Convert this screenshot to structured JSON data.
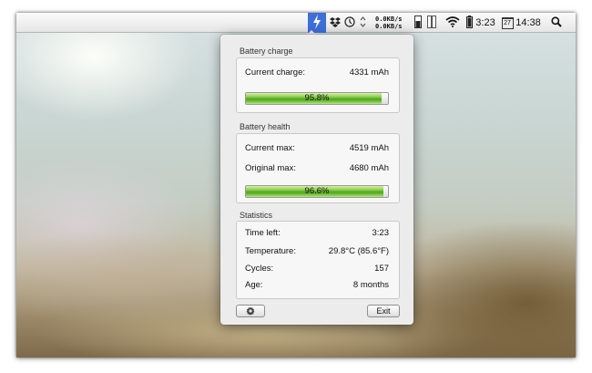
{
  "menubar": {
    "net_up": "0.0KB/s",
    "net_down": "0.0KB/s",
    "battery_time": "3:23",
    "calendar_day": "27",
    "clock": "14:38",
    "icons": [
      "bolt-icon",
      "dropbox-icon",
      "clock-icon",
      "stepper-icon",
      "network-monitor",
      "memory-icon",
      "cpu-icon",
      "wifi-icon",
      "battery-icon",
      "calendar-icon",
      "spotlight-icon"
    ],
    "highlight_color": "#3e6fd8"
  },
  "battery_charge": {
    "title": "Battery charge",
    "current_label": "Current charge:",
    "current_value": "4331 mAh",
    "percent_text": "95.8%",
    "percent": 95.8
  },
  "battery_health": {
    "title": "Battery health",
    "current_max_label": "Current max:",
    "current_max_value": "4519 mAh",
    "original_max_label": "Original max:",
    "original_max_value": "4680 mAh",
    "percent_text": "96.6%",
    "percent": 96.6
  },
  "statistics": {
    "title": "Statistics",
    "rows": [
      {
        "label": "Time left:",
        "value": "3:23"
      },
      {
        "label": "Temperature:",
        "value": "29.8°C (85.6°F)"
      },
      {
        "label": "Cycles:",
        "value": "157"
      },
      {
        "label": "Age:",
        "value": "8 months"
      }
    ]
  },
  "footer": {
    "settings_icon": "gear-icon",
    "exit_label": "Exit"
  }
}
